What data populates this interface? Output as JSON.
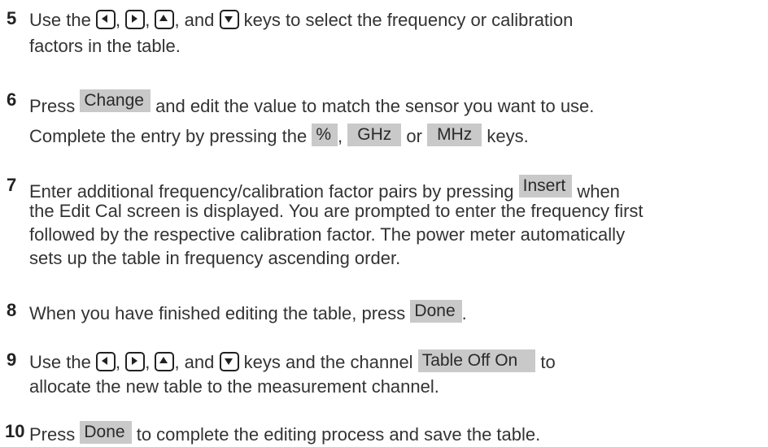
{
  "steps": [
    {
      "num": "5",
      "a": "Use the",
      "sep1": ",",
      "sep2": ",",
      "and": ", and",
      "b": "keys to select the frequency or calibration",
      "c": "factors in the table."
    },
    {
      "num": "6",
      "a": "Press",
      "key": "Change",
      "b": "and edit the value to match the sensor you want to use.",
      "c": "Complete the entry by pressing the",
      "k1": "%",
      "sep": ",",
      "k2": "GHz",
      "or": "or",
      "k3": "MHz",
      "d": "keys."
    },
    {
      "num": "7",
      "a": "Enter additional frequency/calibration factor pairs by pressing",
      "key": "Insert",
      "b": "when",
      "c": "the Edit Cal screen is displayed. You are prompted to enter the frequency first",
      "d": "followed by the respective calibration factor. The power meter automatically",
      "e": "sets up the table in frequency ascending order."
    },
    {
      "num": "8",
      "a": "When you have finished editing the table, press",
      "key": "Done",
      "b": "."
    },
    {
      "num": "9",
      "a": "Use the",
      "sep1": ",",
      "sep2": ",",
      "and": ", and",
      "b": "keys and the channel",
      "key": "Table Off On",
      "c": "to",
      "d": "allocate the new table to the measurement channel."
    },
    {
      "num": "10",
      "a": "Press",
      "key": "Done",
      "b": "to complete the editing process and save the table."
    }
  ],
  "icons": [
    "arrow-left-key-icon",
    "arrow-right-key-icon",
    "arrow-up-key-icon",
    "arrow-down-key-icon"
  ]
}
